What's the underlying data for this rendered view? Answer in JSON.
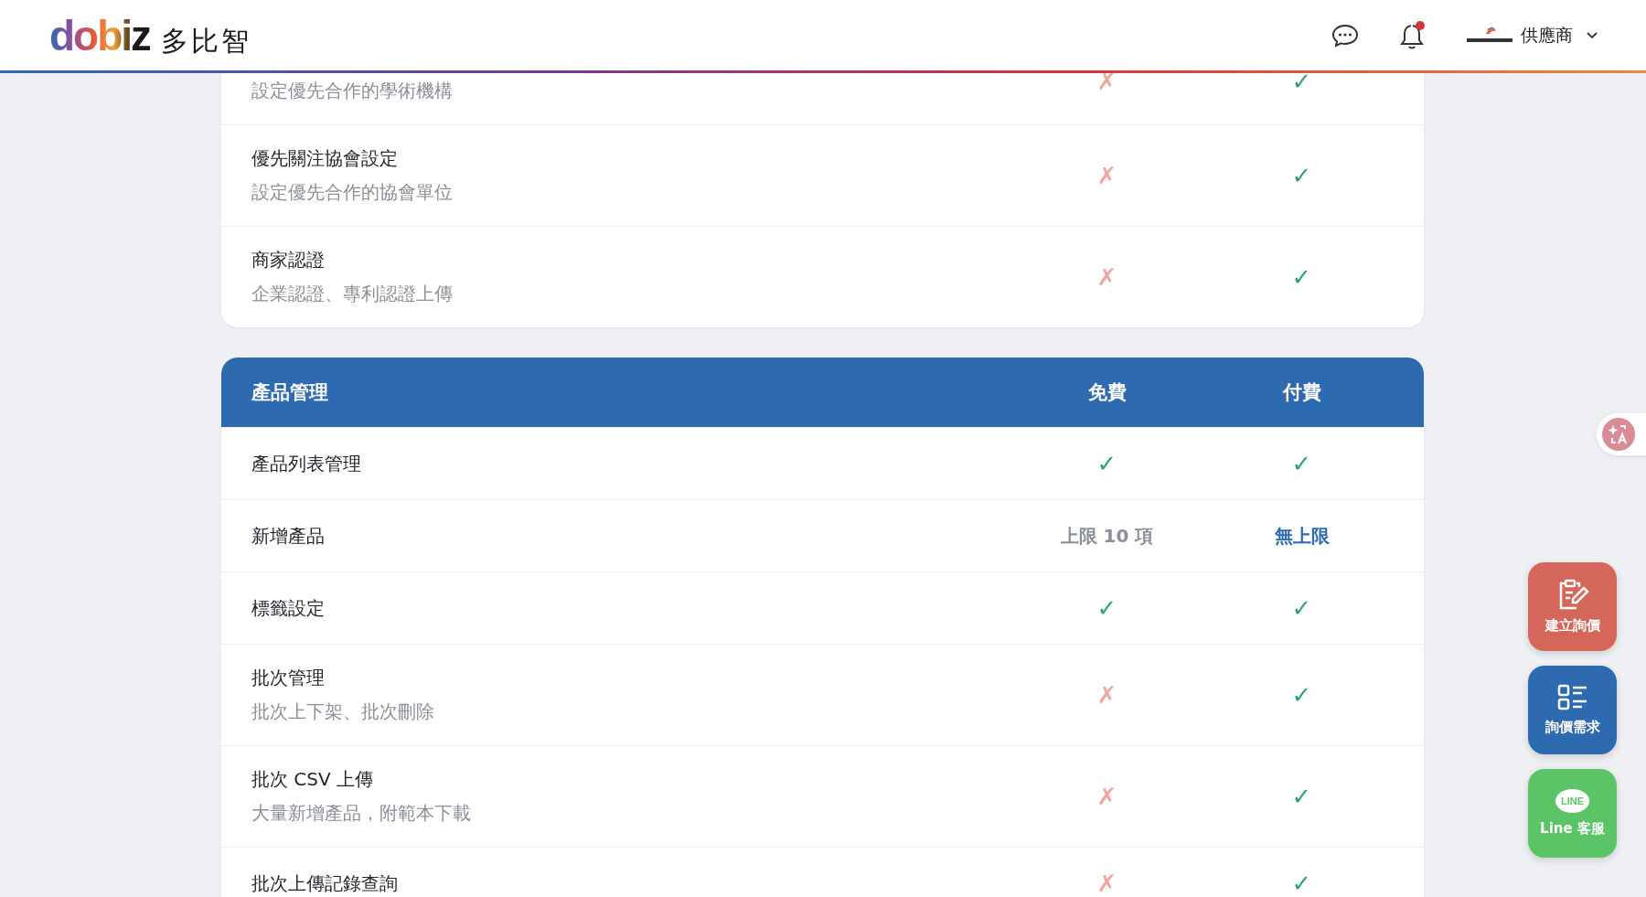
{
  "header": {
    "logo_text": "dobiz",
    "brand": "多比智",
    "notifications": {
      "unread": true
    },
    "user": {
      "role": "供應商"
    }
  },
  "sections": [
    {
      "rows": [
        {
          "subtitle": "設定優先合作的學術機構",
          "free": {
            "kind": "no",
            "text": "✗"
          },
          "paid": {
            "kind": "yes",
            "text": "✓"
          }
        },
        {
          "title": "優先關注協會設定",
          "subtitle": "設定優先合作的協會單位",
          "free": {
            "kind": "no",
            "text": "✗"
          },
          "paid": {
            "kind": "yes",
            "text": "✓"
          }
        },
        {
          "title": "商家認證",
          "subtitle": "企業認證、專利認證上傳",
          "free": {
            "kind": "no",
            "text": "✗"
          },
          "paid": {
            "kind": "yes",
            "text": "✓"
          }
        }
      ]
    },
    {
      "heading": {
        "title": "產品管理",
        "free": "免費",
        "paid": "付費"
      },
      "rows": [
        {
          "title": "產品列表管理",
          "free": {
            "kind": "yes",
            "text": "✓"
          },
          "paid": {
            "kind": "yes",
            "text": "✓"
          }
        },
        {
          "title": "新增產品",
          "free": {
            "kind": "limit",
            "text": "上限 10 項"
          },
          "paid": {
            "kind": "unlimited",
            "text": "無上限"
          }
        },
        {
          "title": "標籤設定",
          "free": {
            "kind": "yes",
            "text": "✓"
          },
          "paid": {
            "kind": "yes",
            "text": "✓"
          }
        },
        {
          "title": "批次管理",
          "subtitle": "批次上下架、批次刪除",
          "free": {
            "kind": "no",
            "text": "✗"
          },
          "paid": {
            "kind": "yes",
            "text": "✓"
          }
        },
        {
          "title": "批次 CSV 上傳",
          "subtitle": "大量新增產品，附範本下載",
          "free": {
            "kind": "no",
            "text": "✗"
          },
          "paid": {
            "kind": "yes",
            "text": "✓"
          }
        },
        {
          "title": "批次上傳記錄查詢",
          "free": {
            "kind": "no",
            "text": "✗"
          },
          "paid": {
            "kind": "yes",
            "text": "✓"
          }
        }
      ]
    }
  ],
  "floating_buttons": [
    {
      "kind": "quote",
      "label": "建立詢價"
    },
    {
      "kind": "requests",
      "label": "詢價需求"
    },
    {
      "kind": "line",
      "label": "Line 客服",
      "icon_text": "LINE"
    }
  ]
}
